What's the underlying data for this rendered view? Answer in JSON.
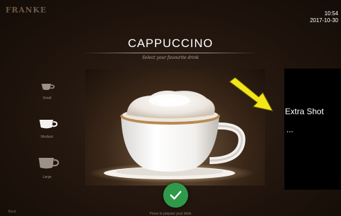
{
  "brand": {
    "logo_text": "FRANKE"
  },
  "status": {
    "time": "10:54",
    "date": "2017-10-30"
  },
  "product": {
    "title": "CAPPUCCINO",
    "subtitle": "Select your favourite drink"
  },
  "sizes": [
    {
      "label": "Small"
    },
    {
      "label": "Medium"
    },
    {
      "label": "Large"
    }
  ],
  "extra": {
    "label": "Extra Shot",
    "ellipsis": "..."
  },
  "footer": {
    "hint": "Press to prepare your drink",
    "back": "Back"
  },
  "colors": {
    "confirm": "#2f9a4a",
    "arrow": "#f2e51a"
  },
  "icons": {
    "confirm": "check-icon",
    "pointer": "arrow-icon"
  }
}
